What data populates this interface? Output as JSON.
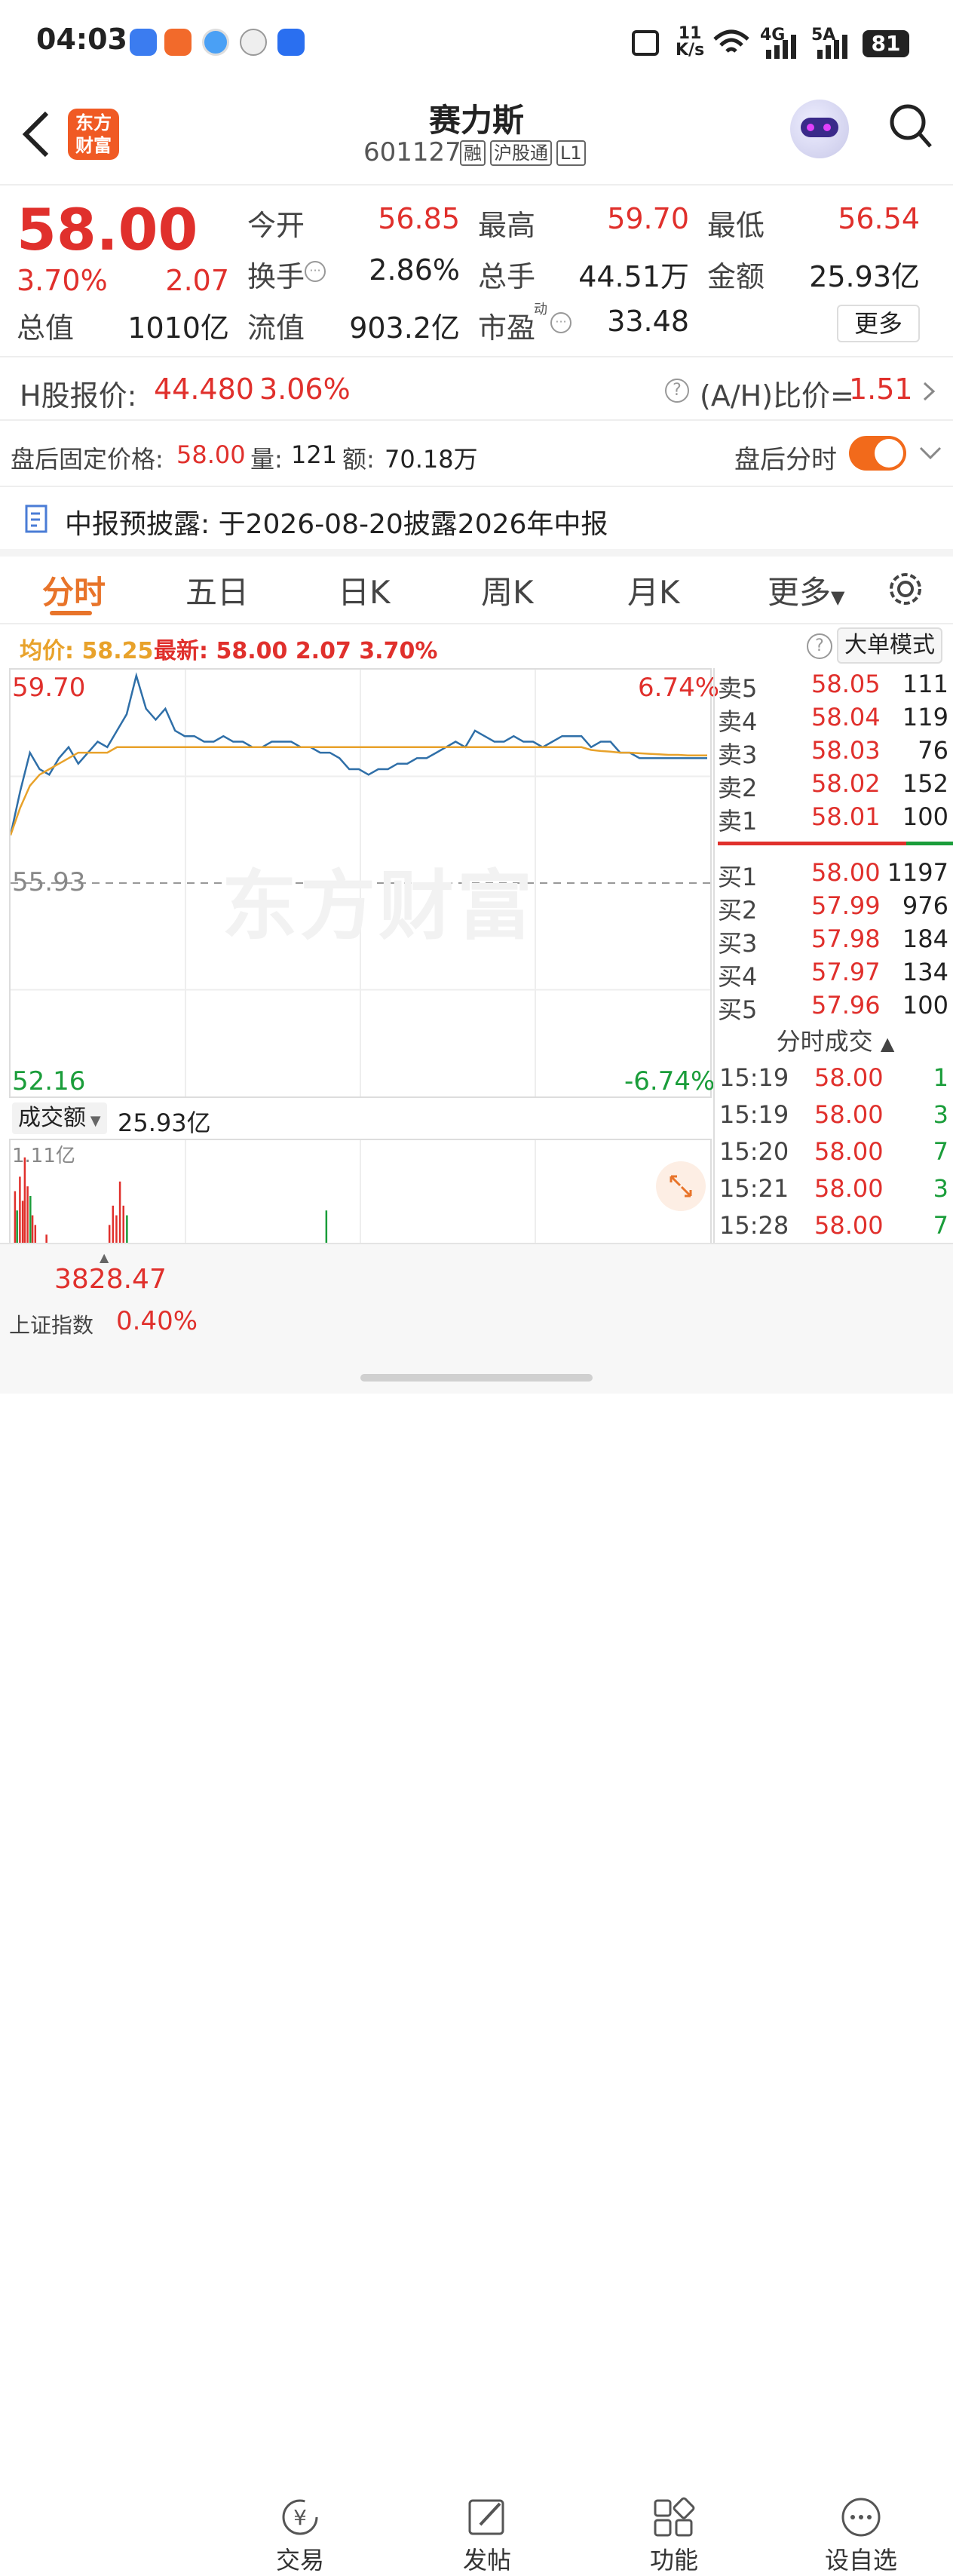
{
  "status": {
    "time": "04:03",
    "net_speed_num": "11",
    "net_speed_unit": "K/s",
    "sig1": "4G",
    "sig2": "5A",
    "battery": "81"
  },
  "header": {
    "app_logo": "东方\n财富",
    "name": "赛力斯",
    "code": "601127",
    "badges": [
      "融",
      "沪股通",
      "L1"
    ]
  },
  "quote": {
    "price": "58.00",
    "pct": "3.70%",
    "change": "2.07",
    "cells": [
      {
        "label": "今开",
        "value": "56.85",
        "color": "red"
      },
      {
        "label": "最高",
        "value": "59.70",
        "color": "red"
      },
      {
        "label": "最低",
        "value": "56.54",
        "color": "red"
      },
      {
        "label": "换手",
        "value": "2.86%",
        "color": "black"
      },
      {
        "label": "总手",
        "value": "44.51万",
        "color": "black"
      },
      {
        "label": "金额",
        "value": "25.93亿",
        "color": "black"
      },
      {
        "label": "流值",
        "value": "903.2亿",
        "color": "black"
      },
      {
        "label": "市盈",
        "value": "33.48",
        "color": "black"
      }
    ],
    "total_label": "总值",
    "total_value": "1010亿",
    "pe_sup": "动",
    "more": "更多"
  },
  "hshare": {
    "label": "H股报价:",
    "price": "44.480",
    "pct": "3.06%",
    "ratio_label": "(A/H)比价=",
    "ratio": "1.51"
  },
  "afterhours": {
    "price_label": "盘后固定价格:",
    "price": "58.00",
    "vol_label": "量:",
    "vol": "121",
    "amt_label": "额:",
    "amt": "70.18万",
    "toggle_label": "盘后分时",
    "toggle_on": true
  },
  "notice": {
    "text": "中报预披露:  于2026-08-20披露2026年中报"
  },
  "tabs": [
    "分时",
    "五日",
    "日K",
    "周K",
    "月K",
    "更多"
  ],
  "chart_info": {
    "avg_label": "均价:",
    "avg": "58.25",
    "latest_label": "最新:",
    "latest": "58.00",
    "change": "2.07",
    "pct": "3.70%",
    "mode_btn": "大单模式"
  },
  "chart_data": {
    "type": "line",
    "ylim": [
      52.16,
      59.7
    ],
    "y_ticks": {
      "top": "59.70",
      "mid": "55.93",
      "bottom": "52.16",
      "top_pct": "6.74%",
      "bottom_pct": "-6.74%"
    },
    "watermark": "东方财富",
    "series": [
      {
        "color": "#2f6fa8",
        "values": [
          56.8,
          57.6,
          58.3,
          58.0,
          57.9,
          58.2,
          58.4,
          58.1,
          58.3,
          58.5,
          58.4,
          58.7,
          59.0,
          59.7,
          59.1,
          58.9,
          59.1,
          58.7,
          58.6,
          58.6,
          58.5,
          58.5,
          58.6,
          58.5,
          58.5,
          58.4,
          58.4,
          58.5,
          58.5,
          58.5,
          58.4,
          58.4,
          58.3,
          58.3,
          58.2,
          58.0,
          58.0,
          57.9,
          58.0,
          58.0,
          58.1,
          58.1,
          58.2,
          58.2,
          58.3,
          58.4,
          58.5,
          58.4,
          58.7,
          58.6,
          58.5,
          58.5,
          58.6,
          58.5,
          58.5,
          58.4,
          58.5,
          58.6,
          58.6,
          58.6,
          58.4,
          58.5,
          58.5,
          58.3,
          58.3,
          58.2,
          58.2,
          58.2,
          58.2,
          58.2,
          58.2,
          58.2,
          58.2
        ]
      },
      {
        "color": "#e8a22b",
        "values": [
          56.8,
          57.3,
          57.7,
          57.9,
          58.0,
          58.1,
          58.2,
          58.3,
          58.3,
          58.3,
          58.3,
          58.4,
          58.4,
          58.4,
          58.4,
          58.4,
          58.4,
          58.4,
          58.4,
          58.4,
          58.4,
          58.4,
          58.4,
          58.4,
          58.4,
          58.4,
          58.4,
          58.4,
          58.4,
          58.4,
          58.4,
          58.4,
          58.4,
          58.4,
          58.4,
          58.4,
          58.4,
          58.4,
          58.4,
          58.4,
          58.4,
          58.4,
          58.4,
          58.4,
          58.4,
          58.4,
          58.4,
          58.4,
          58.4,
          58.4,
          58.4,
          58.4,
          58.4,
          58.4,
          58.4,
          58.4,
          58.4,
          58.4,
          58.4,
          58.4,
          58.35,
          58.33,
          58.32,
          58.3,
          58.3,
          58.29,
          58.28,
          58.27,
          58.26,
          58.26,
          58.25,
          58.25,
          58.25
        ]
      }
    ]
  },
  "volume": {
    "label": "成交额",
    "value": "25.93亿",
    "max_label": "1.11亿",
    "bars": [
      {
        "x": 0.005,
        "h": 0.55,
        "c": "red"
      },
      {
        "x": 0.008,
        "h": 0.35,
        "c": "green"
      },
      {
        "x": 0.012,
        "h": 0.7,
        "c": "red"
      },
      {
        "x": 0.016,
        "h": 0.45,
        "c": "red"
      },
      {
        "x": 0.019,
        "h": 0.9,
        "c": "red"
      },
      {
        "x": 0.023,
        "h": 0.6,
        "c": "red"
      },
      {
        "x": 0.027,
        "h": 0.5,
        "c": "green"
      },
      {
        "x": 0.03,
        "h": 0.3,
        "c": "red"
      },
      {
        "x": 0.034,
        "h": 0.2,
        "c": "red"
      },
      {
        "x": 0.05,
        "h": 0.1,
        "c": "red"
      },
      {
        "x": 0.14,
        "h": 0.2,
        "c": "red"
      },
      {
        "x": 0.145,
        "h": 0.4,
        "c": "red"
      },
      {
        "x": 0.15,
        "h": 0.3,
        "c": "red"
      },
      {
        "x": 0.155,
        "h": 0.65,
        "c": "red"
      },
      {
        "x": 0.16,
        "h": 0.4,
        "c": "red"
      },
      {
        "x": 0.165,
        "h": 0.3,
        "c": "green"
      },
      {
        "x": 0.45,
        "h": 0.35,
        "c": "green"
      }
    ]
  },
  "orderbook": {
    "asks": [
      {
        "l": "卖5",
        "p": "58.05",
        "v": "111"
      },
      {
        "l": "卖4",
        "p": "58.04",
        "v": "119"
      },
      {
        "l": "卖3",
        "p": "58.03",
        "v": "76"
      },
      {
        "l": "卖2",
        "p": "58.02",
        "v": "152"
      },
      {
        "l": "卖1",
        "p": "58.01",
        "v": "100"
      }
    ],
    "bids": [
      {
        "l": "买1",
        "p": "58.00",
        "v": "1197"
      },
      {
        "l": "买2",
        "p": "57.99",
        "v": "976"
      },
      {
        "l": "买3",
        "p": "57.98",
        "v": "184"
      },
      {
        "l": "买4",
        "p": "57.97",
        "v": "134"
      },
      {
        "l": "买5",
        "p": "57.96",
        "v": "100"
      }
    ],
    "balance": 0.8
  },
  "ticks": {
    "title": "分时成交",
    "rows": [
      {
        "t": "15:19",
        "p": "58.00",
        "v": "1"
      },
      {
        "t": "15:19",
        "p": "58.00",
        "v": "3"
      },
      {
        "t": "15:20",
        "p": "58.00",
        "v": "7"
      },
      {
        "t": "15:21",
        "p": "58.00",
        "v": "3"
      },
      {
        "t": "15:28",
        "p": "58.00",
        "v": "7"
      }
    ]
  },
  "bottom": {
    "index_value": "3828.47",
    "index_name": "上证指数",
    "index_pct": "0.40%",
    "nav": [
      {
        "label": "交易",
        "icon": "yen-icon"
      },
      {
        "label": "发帖",
        "icon": "edit-icon"
      },
      {
        "label": "功能",
        "icon": "grid-icon"
      },
      {
        "label": "设自选",
        "icon": "more-icon"
      }
    ]
  }
}
